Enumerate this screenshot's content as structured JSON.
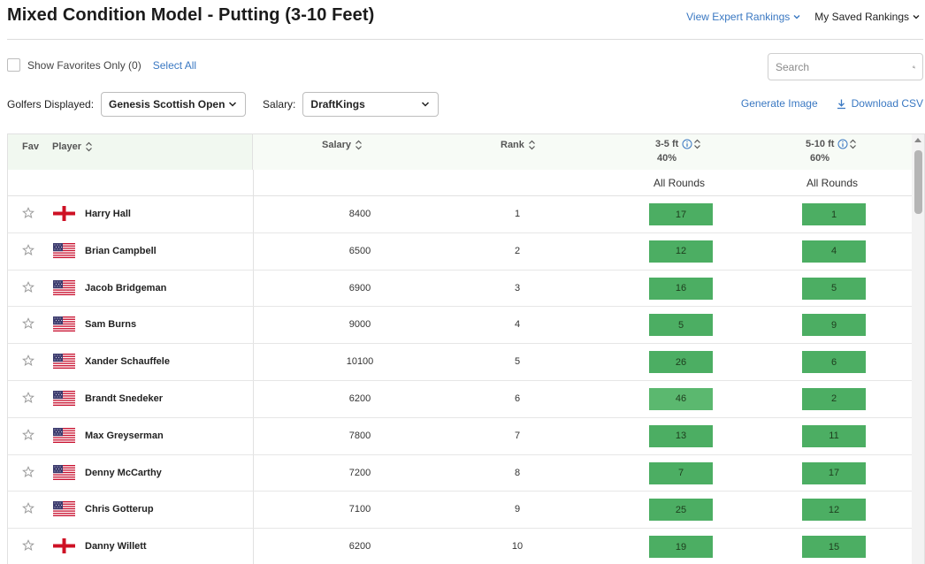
{
  "page": {
    "title": "Mixed Condition Model - Putting (3-10 Feet)",
    "view_expert_rankings": "View Expert Rankings",
    "my_saved_rankings": "My Saved Rankings"
  },
  "controls": {
    "show_favorites": "Show Favorites Only (0)",
    "select_all": "Select All",
    "search_placeholder": "Search",
    "golfers_label": "Golfers Displayed:",
    "golfers_value": "Genesis Scottish Open",
    "salary_label": "Salary:",
    "salary_value": "DraftKings",
    "generate_image": "Generate Image",
    "download_csv": "Download CSV"
  },
  "table": {
    "headers": {
      "fav": "Fav",
      "player": "Player",
      "salary": "Salary",
      "rank": "Rank",
      "col1": "3-5 ft",
      "col1_pct": "40%",
      "col1_sub": "All Rounds",
      "col2": "5-10 ft",
      "col2_pct": "60%",
      "col2_sub": "All Rounds"
    },
    "rows": [
      {
        "name": "Harry Hall",
        "flag": "england",
        "salary": "8400",
        "rank": "1",
        "c1": "17",
        "c2": "1"
      },
      {
        "name": "Brian Campbell",
        "flag": "usa",
        "salary": "6500",
        "rank": "2",
        "c1": "12",
        "c2": "4"
      },
      {
        "name": "Jacob Bridgeman",
        "flag": "usa",
        "salary": "6900",
        "rank": "3",
        "c1": "16",
        "c2": "5"
      },
      {
        "name": "Sam Burns",
        "flag": "usa",
        "salary": "9000",
        "rank": "4",
        "c1": "5",
        "c2": "9"
      },
      {
        "name": "Xander Schauffele",
        "flag": "usa",
        "salary": "10100",
        "rank": "5",
        "c1": "26",
        "c2": "6"
      },
      {
        "name": "Brandt Snedeker",
        "flag": "usa",
        "salary": "6200",
        "rank": "6",
        "c1": "46",
        "c2": "2"
      },
      {
        "name": "Max Greyserman",
        "flag": "usa",
        "salary": "7800",
        "rank": "7",
        "c1": "13",
        "c2": "11"
      },
      {
        "name": "Denny McCarthy",
        "flag": "usa",
        "salary": "7200",
        "rank": "8",
        "c1": "7",
        "c2": "17"
      },
      {
        "name": "Chris Gotterup",
        "flag": "usa",
        "salary": "7100",
        "rank": "9",
        "c1": "25",
        "c2": "12"
      },
      {
        "name": "Danny Willett",
        "flag": "england",
        "salary": "6200",
        "rank": "10",
        "c1": "19",
        "c2": "15"
      }
    ]
  },
  "colors": {
    "link": "#3a78c2",
    "green_dark": "#4cae63",
    "green_mid": "#5bb86f",
    "header_bg": "#f1f8f0"
  },
  "icons": [
    "chevron-down-icon",
    "search-icon",
    "download-icon",
    "sort-icon",
    "info-icon",
    "star-icon",
    "usa-flag-icon",
    "england-flag-icon"
  ]
}
